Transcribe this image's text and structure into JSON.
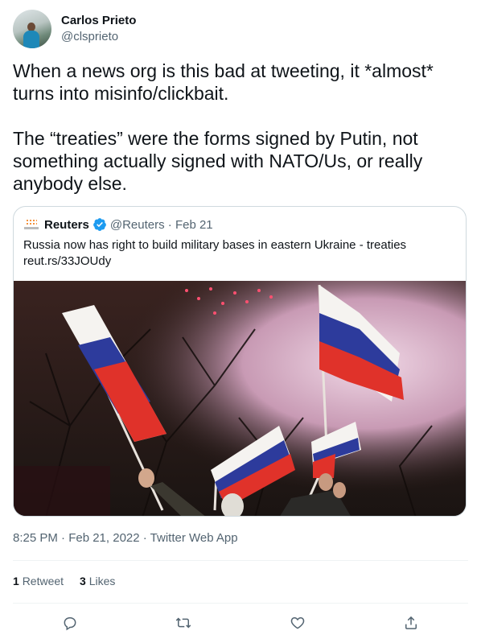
{
  "author": {
    "display_name": "Carlos Prieto",
    "handle": "@clsprieto"
  },
  "tweet": {
    "text": "When a news org is this bad at tweeting, it *almost* turns into misinfo/clickbait.\n\nThe “treaties” were the forms signed by Putin, not something actually signed with NATO/Us, or really anybody else."
  },
  "quoted": {
    "name": "Reuters",
    "meta": "@Reuters · Feb 21",
    "text": "Russia now has right to build military bases in eastern Ukraine - treaties\nreut.rs/33JOUdy",
    "image_icon": "photo-of-russian-flags-waved-at-night-with-fireworks-and-smoke",
    "accent_color": "#1d9bf0"
  },
  "meta_line": "8:25 PM · Feb 21, 2022 · Twitter Web App",
  "stats": {
    "retweets_num": "1",
    "retweets_label": "Retweet",
    "likes_num": "3",
    "likes_label": "Likes"
  },
  "actions": [
    "reply-icon",
    "retweet-icon",
    "like-icon",
    "share-icon"
  ]
}
